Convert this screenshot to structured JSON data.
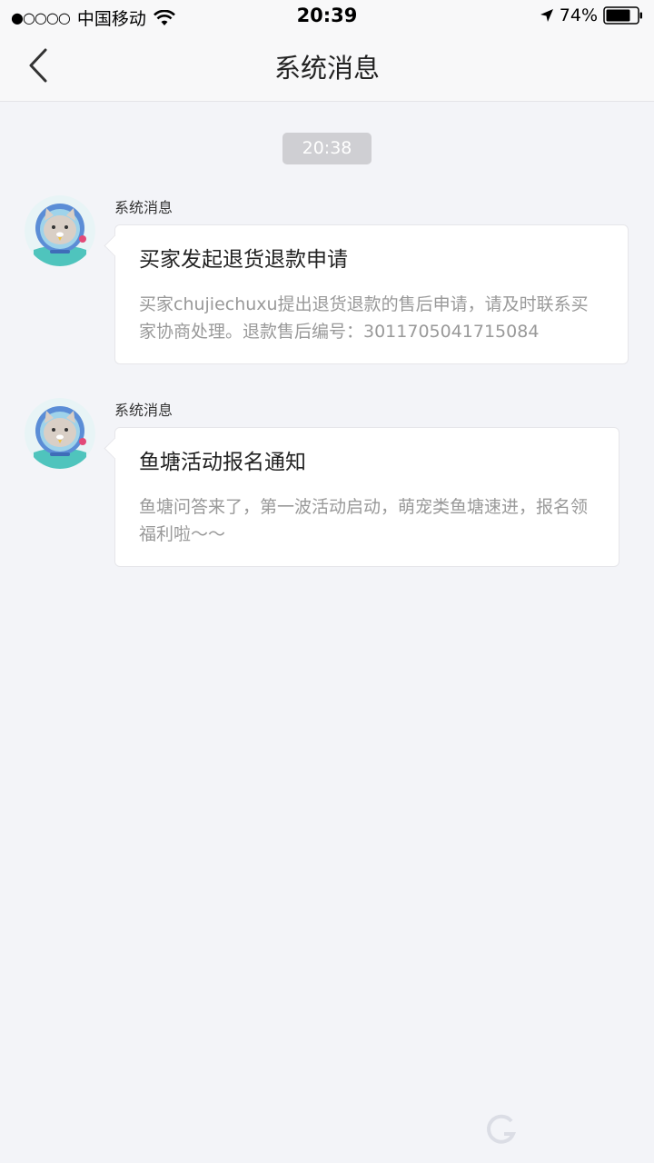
{
  "status_bar": {
    "signal": "●○○○○",
    "carrier": "中国移动",
    "time": "20:39",
    "battery": "74%"
  },
  "nav": {
    "title": "系统消息"
  },
  "timestamp": "20:38",
  "messages": [
    {
      "sender": "系统消息",
      "title": "买家发起退货退款申请",
      "body": "买家chujiechuxu提出退货退款的售后申请，请及时联系买家协商处理。退款售后编号：3011705041715084"
    },
    {
      "sender": "系统消息",
      "title": "鱼塘活动报名通知",
      "body": "鱼塘问答来了，第一波活动启动，萌宠类鱼塘速进，报名领福利啦～～"
    }
  ],
  "icons": {
    "back": "chevron-left-icon",
    "wifi": "wifi-icon",
    "location": "location-arrow-icon",
    "battery": "battery-icon",
    "avatar": "cat-astronaut-avatar"
  },
  "colors": {
    "background": "#f3f4f8",
    "badge": "#cfcfd3",
    "body_text": "#999999"
  }
}
